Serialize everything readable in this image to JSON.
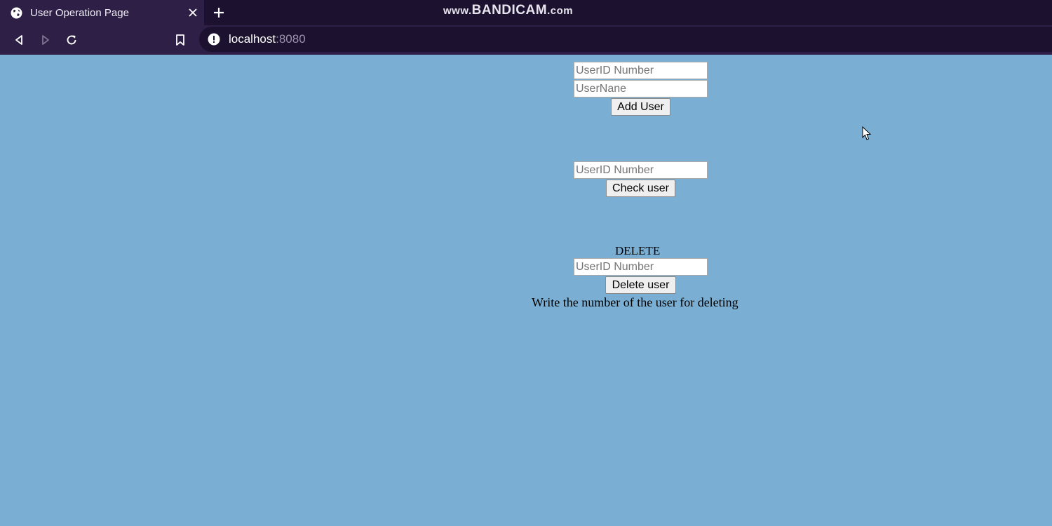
{
  "browser": {
    "tab_title": "User Operation Page",
    "watermark_prefix": "www.",
    "watermark_brand": "BANDICAM",
    "watermark_suffix": ".com",
    "url_host": "localhost",
    "url_port": ":8080"
  },
  "add_section": {
    "userid_placeholder": "UserID Number",
    "username_placeholder": "UserNane",
    "button_label": "Add User"
  },
  "check_section": {
    "userid_placeholder": "UserID Number",
    "button_label": "Check user"
  },
  "delete_section": {
    "heading": "DELETE",
    "userid_placeholder": "UserID Number",
    "button_label": "Delete user",
    "hint": "Write the number of the user for deleting"
  },
  "colors": {
    "page_background": "#7aaed3",
    "chrome_dark": "#1c1230",
    "chrome_tab": "#2d1f45"
  }
}
